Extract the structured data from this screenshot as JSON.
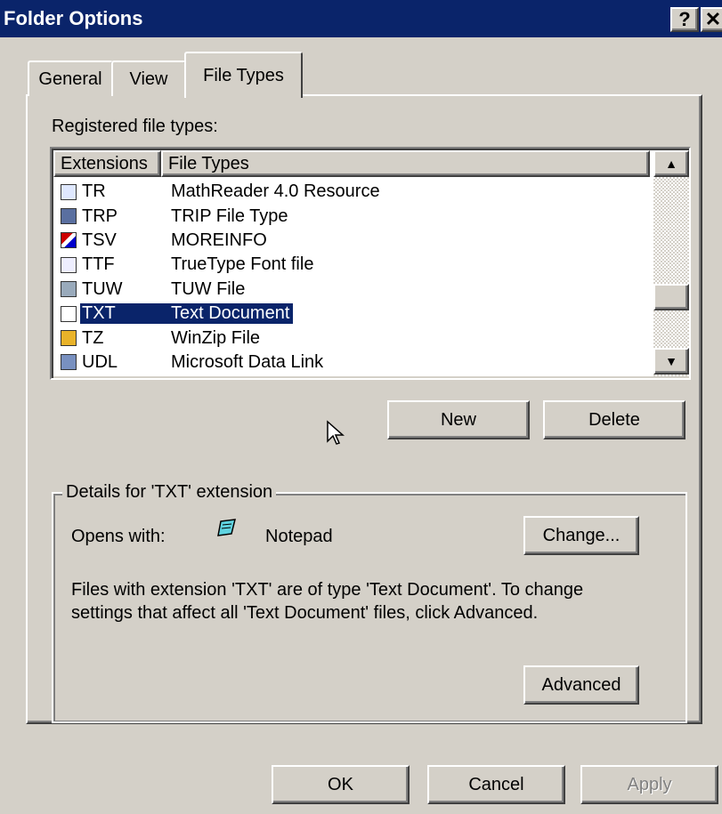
{
  "window": {
    "title": "Folder Options",
    "help_label": "?",
    "close_label": "✕"
  },
  "tabs": [
    {
      "label": "General"
    },
    {
      "label": "View"
    },
    {
      "label": "File Types",
      "active": true
    }
  ],
  "file_types": {
    "label": "Registered file types:",
    "columns": [
      "Extensions",
      "File Types"
    ],
    "rows": [
      {
        "ext": "TR",
        "type": "MathReader 4.0 Resource",
        "icon": "document-icon"
      },
      {
        "ext": "TRP",
        "type": "TRIP File Type",
        "icon": "app-icon"
      },
      {
        "ext": "TSV",
        "type": "MOREINFO",
        "icon": "data-icon"
      },
      {
        "ext": "TTF",
        "type": "TrueType Font file",
        "icon": "font-icon"
      },
      {
        "ext": "TUW",
        "type": "TUW File",
        "icon": "window-icon"
      },
      {
        "ext": "TXT",
        "type": "Text Document",
        "icon": "text-document-icon",
        "selected": true
      },
      {
        "ext": "TZ",
        "type": "WinZip File",
        "icon": "winzip-icon"
      },
      {
        "ext": "UDL",
        "type": "Microsoft Data Link",
        "icon": "data-link-icon"
      }
    ],
    "new_label": "New",
    "delete_label": "Delete"
  },
  "details": {
    "group_label": "Details for 'TXT' extension",
    "opens_with_label": "Opens with:",
    "app_name": "Notepad",
    "change_label": "Change...",
    "description_line1": "Files with extension 'TXT' are of type 'Text Document'.  To change",
    "description_line2": "settings that affect all 'Text Document' files, click Advanced.",
    "advanced_label": "Advanced"
  },
  "footer": {
    "ok_label": "OK",
    "cancel_label": "Cancel",
    "apply_label": "Apply"
  }
}
